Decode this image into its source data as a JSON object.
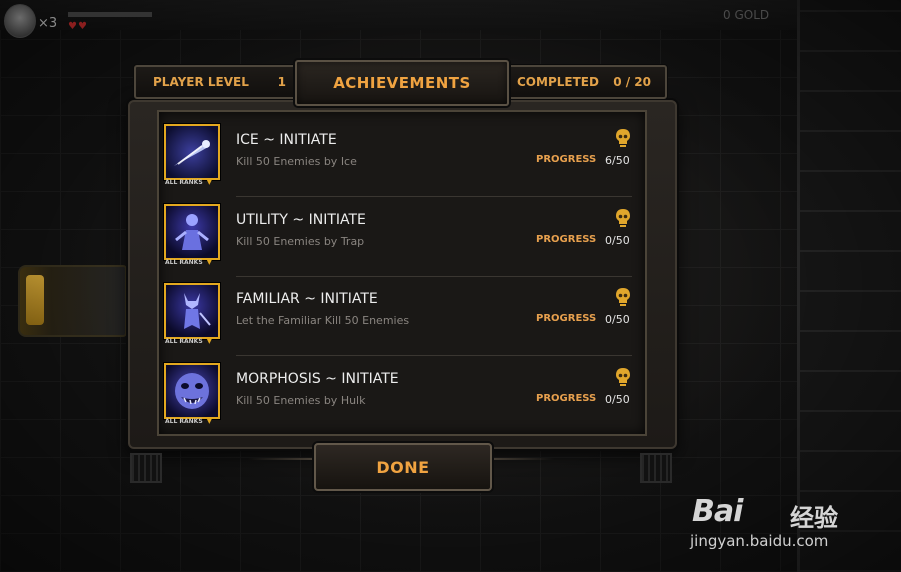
{
  "hud": {
    "lives": "×3",
    "gold": "0 GOLD"
  },
  "header": {
    "player_level_label": "PLAYER LEVEL",
    "player_level_value": "1",
    "title": "ACHIEVEMENTS",
    "completed_label": "COMPLETED",
    "completed_value": "0 / 20"
  },
  "achievements": [
    {
      "title": "ICE ~ INITIATE",
      "description": "Kill 50 Enemies by Ice",
      "ranks_label": "ALL RANKS",
      "progress_label": "PROGRESS",
      "progress": "6/50",
      "icon": "ice-shard-icon"
    },
    {
      "title": "UTILITY ~ INITIATE",
      "description": "Kill 50 Enemies by Trap",
      "ranks_label": "ALL RANKS",
      "progress_label": "PROGRESS",
      "progress": "0/50",
      "icon": "trap-figure-icon"
    },
    {
      "title": "FAMILIAR ~ INITIATE",
      "description": "Let the Familiar Kill 50 Enemies",
      "ranks_label": "ALL RANKS",
      "progress_label": "PROGRESS",
      "progress": "0/50",
      "icon": "familiar-creature-icon"
    },
    {
      "title": "MORPHOSIS ~ INITIATE",
      "description": "Kill 50 Enemies by Hulk",
      "ranks_label": "ALL RANKS",
      "progress_label": "PROGRESS",
      "progress": "0/50",
      "icon": "hulk-face-icon"
    }
  ],
  "done_label": "DONE",
  "watermark": {
    "brand": "Bai",
    "brand_cn": "经验",
    "url": "jingyan.baidu.com"
  },
  "colors": {
    "accent_orange": "#f0a341",
    "icon_border_gold": "#e3a81f",
    "text_light": "#ededed",
    "text_muted": "#8a8580"
  }
}
